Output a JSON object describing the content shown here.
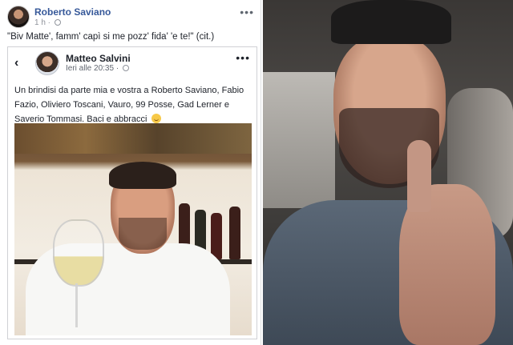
{
  "post": {
    "author": "Roberto Saviano",
    "time": "1 h ·",
    "text": "\"Biv Matte', famm' capì si me pozz' fida' 'e te!\" (cit.)",
    "more": "•••"
  },
  "shared_post": {
    "back": "‹",
    "author": "Matteo Salvini",
    "time": "Ieri alle 20:35 ·",
    "more": "•••",
    "text": "Un brindisi da parte mia e vostra a Roberto Saviano, Fabio Fazio, Oliviero Toscani, Vauro, 99 Posse, Gad Lerner e Saverio Tommasi. Baci e abbracci"
  },
  "colors": {
    "link_blue": "#365899",
    "meta_grey": "#90949c",
    "text_dark": "#1d2129"
  },
  "icons": [
    "globe-icon",
    "more-icon",
    "back-arrow-icon",
    "smile-emoji-icon"
  ]
}
